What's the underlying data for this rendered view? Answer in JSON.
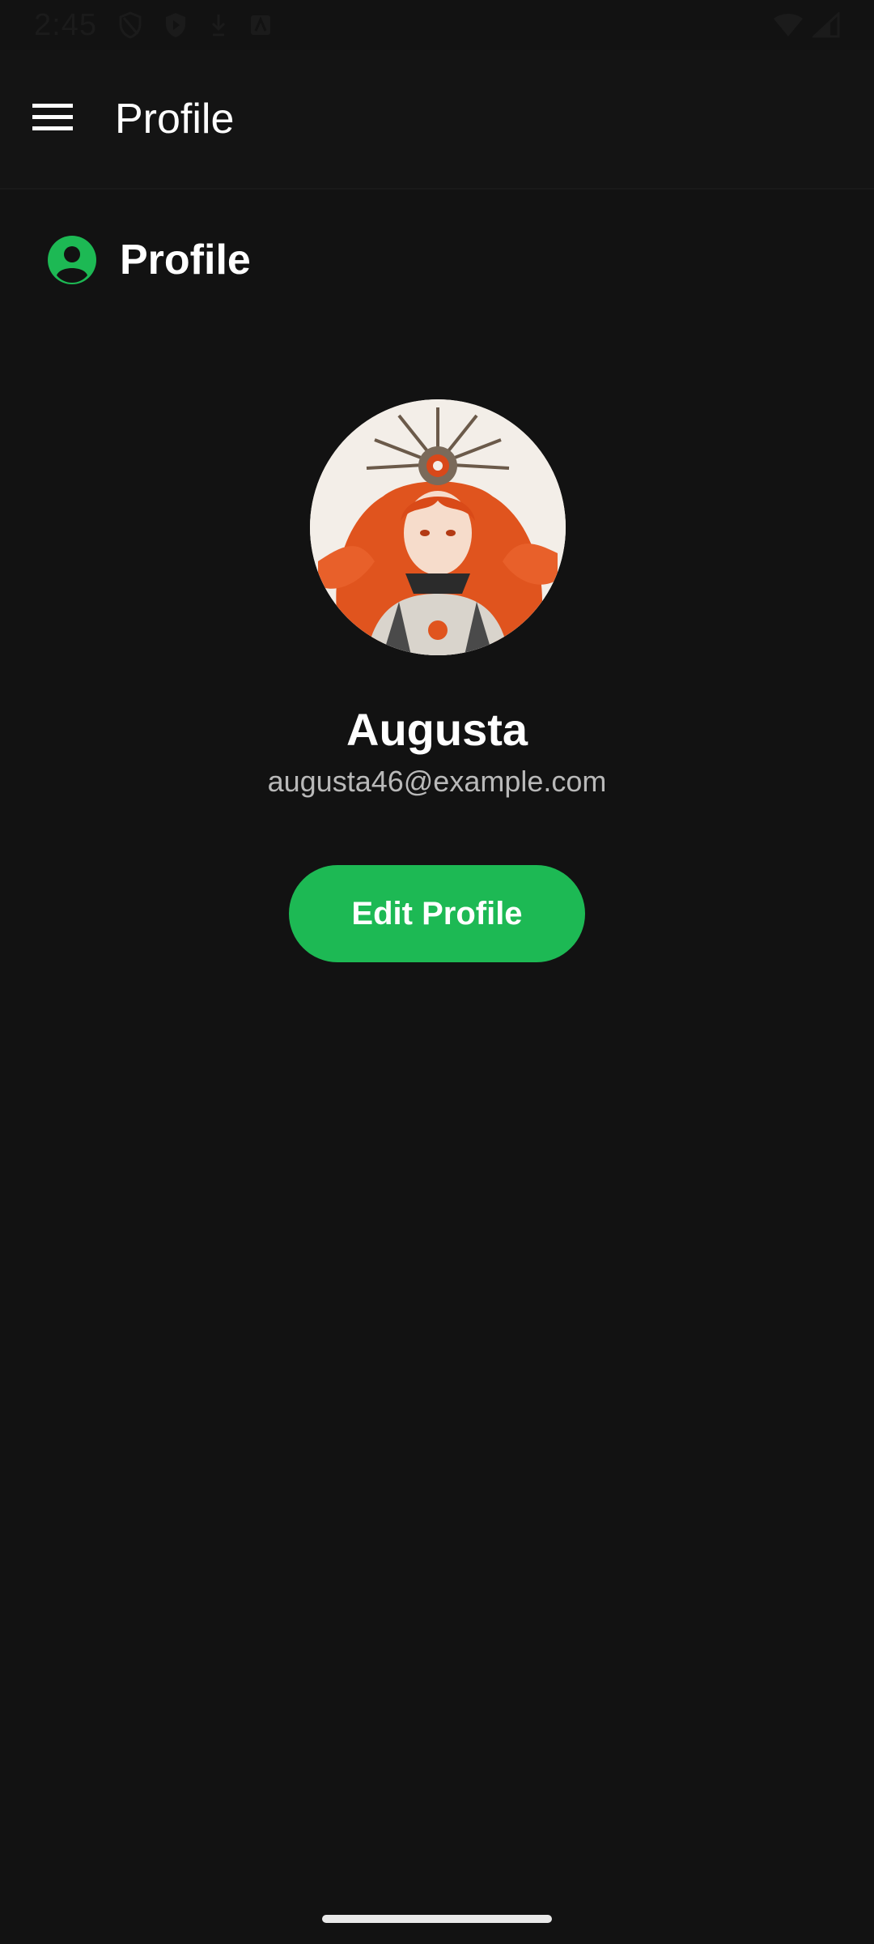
{
  "status_bar": {
    "time": "2:45"
  },
  "app_bar": {
    "title": "Profile"
  },
  "section": {
    "title": "Profile"
  },
  "profile": {
    "name": "Augusta",
    "email": "augusta46@example.com"
  },
  "actions": {
    "edit_label": "Edit Profile"
  },
  "colors": {
    "background": "#121212",
    "accent": "#1db954",
    "text_primary": "#ffffff",
    "text_secondary": "#b9b9b9"
  },
  "icons": {
    "menu": "hamburger-menu-icon",
    "section": "account-circle-icon"
  }
}
